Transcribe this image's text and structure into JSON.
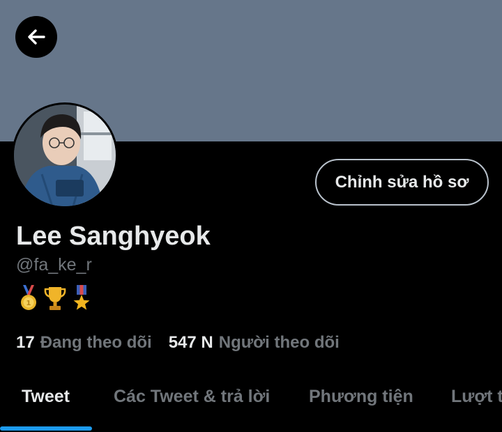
{
  "header": {
    "back_icon": "arrow-left-icon",
    "banner_color": "#66768a"
  },
  "profile": {
    "name": "Lee Sanghyeok",
    "handle": "@fa_ke_r",
    "edit_button_label": "Chỉnh sửa hồ sơ",
    "badges": [
      "gold-medal-icon",
      "trophy-icon",
      "military-medal-icon"
    ]
  },
  "stats": {
    "following_count": "17",
    "following_label": "Đang theo dõi",
    "followers_count": "547 N",
    "followers_label": "Người theo dõi"
  },
  "tabs": [
    {
      "label": "Tweet",
      "active": true
    },
    {
      "label": "Các Tweet & trả lời",
      "active": false
    },
    {
      "label": "Phương tiện",
      "active": false
    },
    {
      "label": "Lượt thích",
      "active": false
    }
  ],
  "colors": {
    "accent": "#1d9bf0",
    "muted_text": "#71767b",
    "primary_text": "#e7e9ea",
    "background": "#000000"
  }
}
